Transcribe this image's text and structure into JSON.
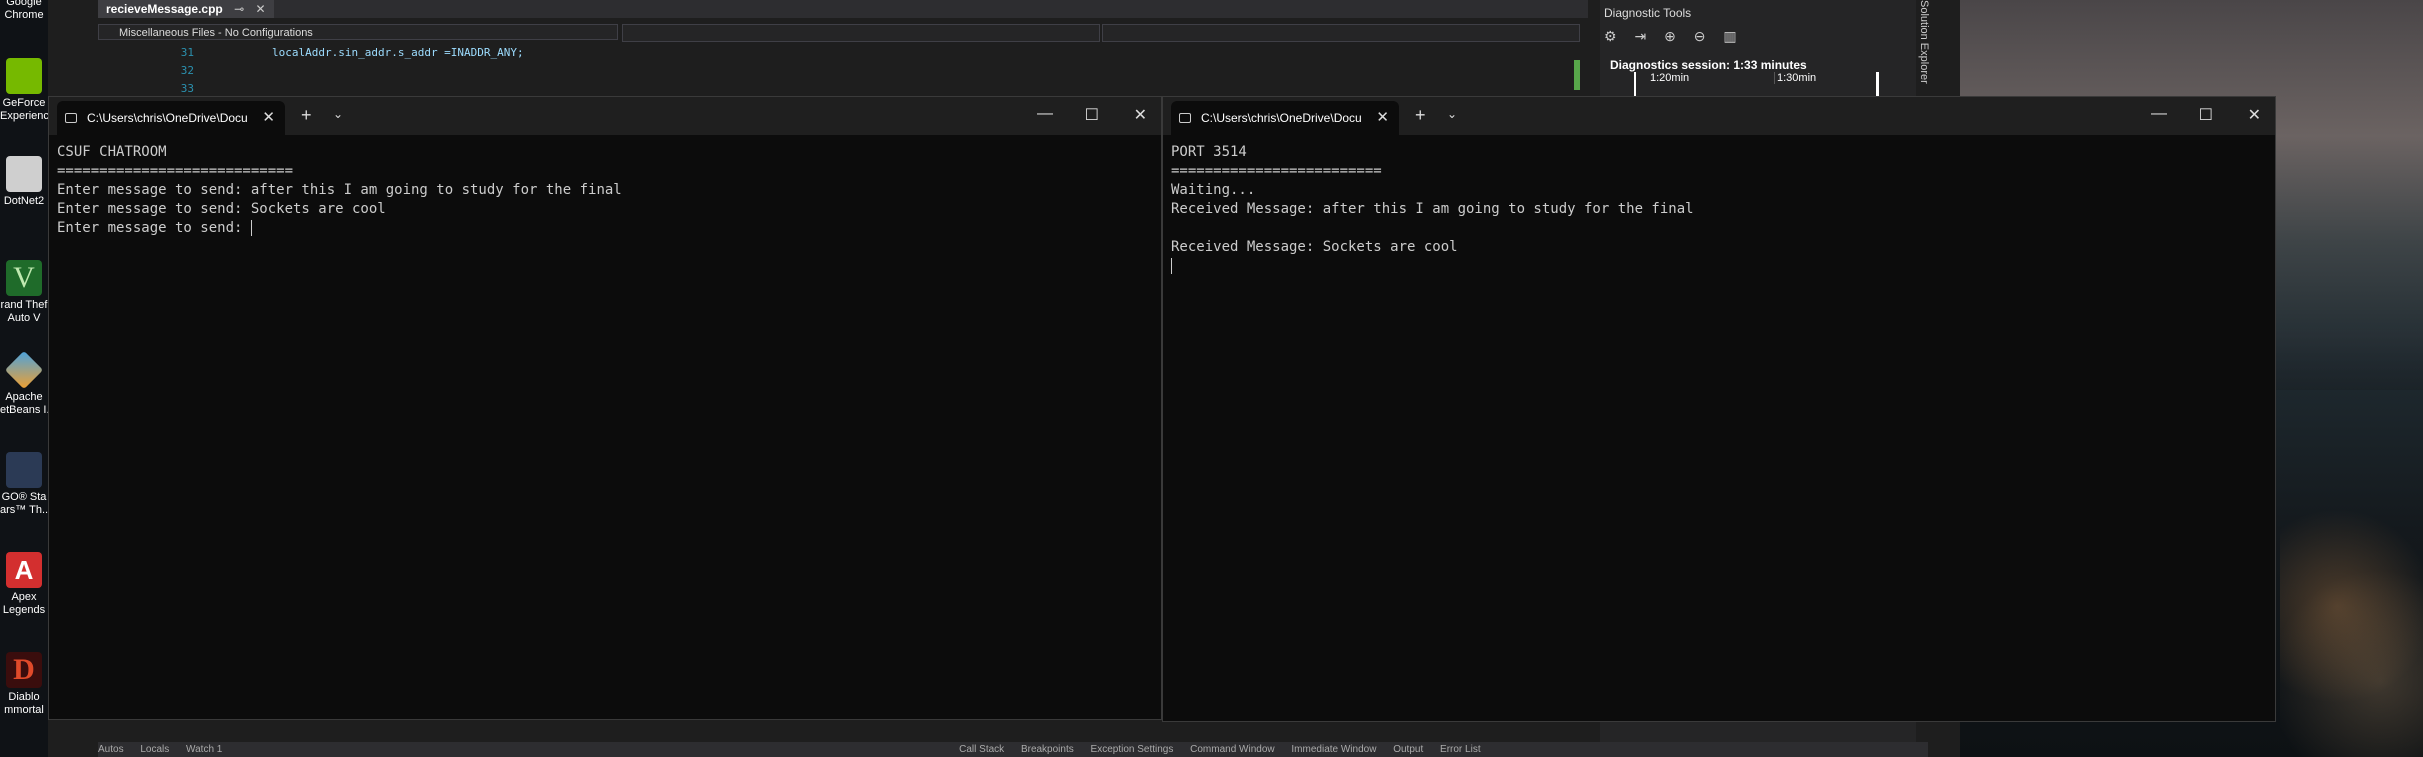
{
  "desktop": {
    "icons": [
      {
        "label": "Google Chrome",
        "line1": "Google",
        "line2": "Chrome",
        "color": "#3a7bd5"
      },
      {
        "label": "GeForce Experience",
        "line1": "GeForce",
        "line2": "Experience",
        "color": "#76b900"
      },
      {
        "label": "DotNet",
        "line1": "DotNet2",
        "line2": "",
        "color": "#cfcfcf"
      },
      {
        "label": "Grand Theft Auto V",
        "line1": "rand Thef",
        "line2": "Auto V",
        "color": "#1f6b2a"
      },
      {
        "label": "Apache NetBeans",
        "line1": "Apache",
        "line2": "etBeans I...",
        "color": "#4aa3df"
      },
      {
        "label": "LEGO Star Wars",
        "line1": "GO® Sta",
        "line2": "ars™ Th...",
        "color": "#2b3a55"
      },
      {
        "label": "Apex Legends",
        "line1": "Apex",
        "line2": "Legends",
        "color": "#d32f2f"
      },
      {
        "label": "Diablo Immortal",
        "line1": "Diablo",
        "line2": "mmortal",
        "color": "#8b1a1a"
      }
    ]
  },
  "vs": {
    "tab_label": "recieveMessage.cpp",
    "tab_pin": "⊸",
    "tab_close": "✕",
    "config_label": "Miscellaneous Files - No Configurations",
    "code_lines": [
      {
        "num": "31",
        "text": "localAddr.sin_addr.s_addr =INADDR_ANY;"
      },
      {
        "num": "32",
        "text": ""
      },
      {
        "num": "33",
        "text": ""
      }
    ],
    "diagnostics": {
      "title": "Diagnostic Tools",
      "session": "Diagnostics session: 1:33 minutes",
      "t1": "1:20min",
      "t2": "1:30min"
    },
    "solution_explorer": "Solution Explorer",
    "bottom_tabs_left": [
      "Autos",
      "Locals",
      "Watch 1"
    ],
    "bottom_tabs_right": [
      "Call Stack",
      "Breakpoints",
      "Exception Settings",
      "Command Window",
      "Immediate Window",
      "Output",
      "Error List"
    ]
  },
  "terminal_left": {
    "tab_title": "C:\\Users\\chris\\OneDrive\\Docu",
    "tab_close": "✕",
    "new_tab": "+",
    "dropdown": "⌄",
    "minimize": "—",
    "maximize": "☐",
    "close": "✕",
    "lines": [
      "CSUF CHATROOM",
      "============================",
      "Enter message to send: after this I am going to study for the final",
      "Enter message to send: Sockets are cool",
      "Enter message to send: "
    ]
  },
  "terminal_right": {
    "tab_title": "C:\\Users\\chris\\OneDrive\\Docu",
    "tab_close": "✕",
    "new_tab": "+",
    "dropdown": "⌄",
    "minimize": "—",
    "maximize": "☐",
    "close": "✕",
    "lines": [
      "PORT 3514",
      "=========================",
      "Waiting...",
      "Received Message: after this I am going to study for the final",
      "",
      "Received Message: Sockets are cool",
      ""
    ]
  }
}
